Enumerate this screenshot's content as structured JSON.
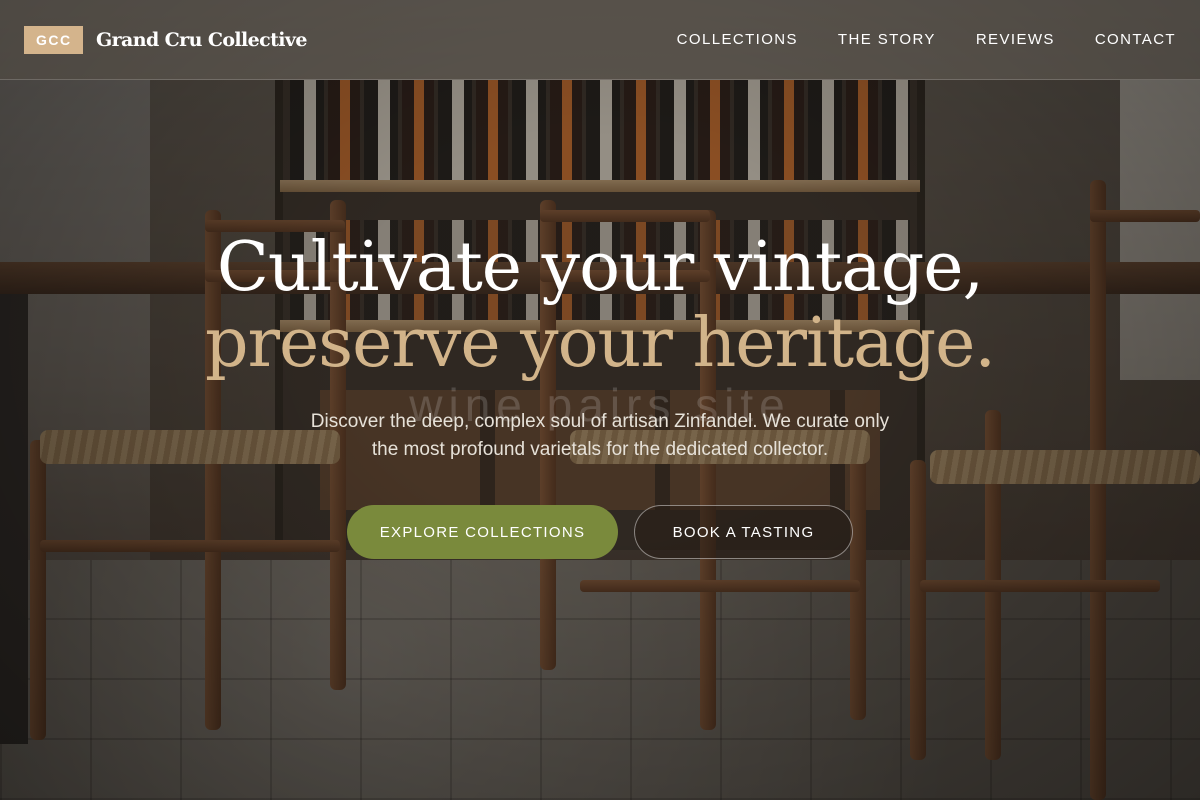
{
  "brand": {
    "badge": "GCC",
    "name": "Grand Cru Collective",
    "badge_color": "#d4b48c"
  },
  "nav": {
    "links": [
      "COLLECTIONS",
      "THE STORY",
      "REVIEWS",
      "CONTACT"
    ]
  },
  "hero": {
    "headline_line1": "Cultivate your vintage,",
    "headline_line2": "preserve your heritage.",
    "ghost_text": "wine pairs site",
    "subtext_line1": "Discover the deep, complex soul of artisan Zinfandel. We curate only",
    "subtext_line2": "the most profound varietals for the dedicated collector.",
    "accent_color": "#d2b48a"
  },
  "cta": {
    "primary_label": "EXPLORE COLLECTIONS",
    "secondary_label": "BOOK A TASTING",
    "primary_color": "#7a8a3c"
  }
}
